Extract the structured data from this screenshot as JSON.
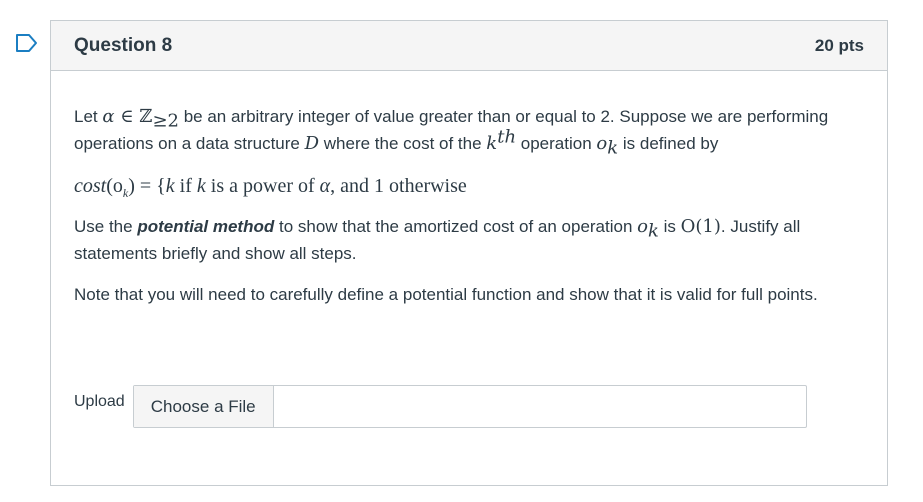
{
  "question": {
    "title": "Question 8",
    "points": "20 pts",
    "flag_icon": "bookmark-flag-icon"
  },
  "body": {
    "p1_a": "Let ",
    "p1_alpha": "α",
    "p1_in": " ∈ ",
    "p1_Z": "ℤ",
    "p1_sub": "≥2",
    "p1_b": " be an arbitrary integer of value greater than or equal to 2. Suppose we are performing operations on a data structure ",
    "p1_D": "D",
    "p1_c": " where the cost of the ",
    "p1_k": "k",
    "p1_th": "th",
    "p1_d": " operation ",
    "p1_o": "o",
    "p1_osub": "k",
    "p1_e": " is defined by",
    "formula_lhs": "cost",
    "formula_arg": "(o",
    "formula_argsub": "k",
    "formula_close": ")",
    "formula_eq": " = {",
    "formula_k1": "k",
    "formula_if": " if ",
    "formula_k2": "k",
    "formula_pow": " is a power of ",
    "formula_alpha": "α",
    "formula_rest": ", and 1 otherwise",
    "p2_a": "Use the ",
    "p2_bold": "potential method",
    "p2_b": " to show that the amortized cost of an operation ",
    "p2_o": "o",
    "p2_osub": "k",
    "p2_c": " is ",
    "p2_O": "O(1)",
    "p2_d": ". Justify all statements briefly and show all steps.",
    "p3": "Note that you will need to carefully define a potential function and show that it is valid for full points."
  },
  "upload": {
    "label": "Upload",
    "button": "Choose a File"
  }
}
